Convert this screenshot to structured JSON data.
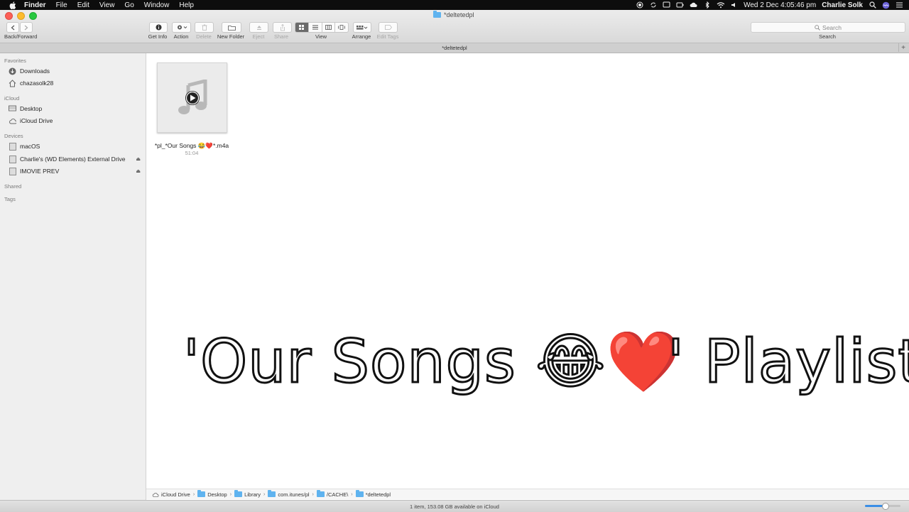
{
  "menubar": {
    "app_name": "Finder",
    "menus": [
      "File",
      "Edit",
      "View",
      "Go",
      "Window",
      "Help"
    ],
    "datetime": "Wed 2 Dec  4:05:46 pm",
    "user": "Charlie Solk",
    "status_icons": [
      "record-icon",
      "sync-icon",
      "screen-icon",
      "battery-icon",
      "cloud-icon",
      "bluetooth-icon",
      "wifi-icon",
      "volume-icon"
    ]
  },
  "window": {
    "title": "*deltetedpl",
    "tab_title": "*deltetedpl"
  },
  "toolbar": {
    "back_forward_label": "Back/Forward",
    "get_info_label": "Get Info",
    "action_label": "Action",
    "delete_label": "Delete",
    "new_folder_label": "New Folder",
    "eject_label": "Eject",
    "share_label": "Share",
    "view_label": "View",
    "arrange_label": "Arrange",
    "edit_tags_label": "Edit Tags",
    "search_placeholder": "Search",
    "search_label": "Search"
  },
  "sidebar": {
    "sections": [
      {
        "title": "Favorites",
        "items": [
          {
            "label": "Downloads",
            "icon": "downloads-icon"
          },
          {
            "label": "chazasolk28",
            "icon": "home-icon"
          }
        ]
      },
      {
        "title": "iCloud",
        "items": [
          {
            "label": "Desktop",
            "icon": "desktop-icon"
          },
          {
            "label": "iCloud Drive",
            "icon": "cloud-icon"
          }
        ]
      },
      {
        "title": "Devices",
        "items": [
          {
            "label": "macOS",
            "icon": "disk-icon"
          },
          {
            "label": "Charlie's (WD Elements) External Drive",
            "icon": "disk-icon",
            "eject": true
          },
          {
            "label": "IMOVIE PREV",
            "icon": "disk-icon",
            "eject": true
          }
        ]
      },
      {
        "title": "Shared",
        "items": []
      },
      {
        "title": "Tags",
        "items": []
      }
    ]
  },
  "content": {
    "file": {
      "name": "*pl_*Our Songs 😂❤️*.m4a",
      "duration": "51:04",
      "icon": "music-file-icon"
    },
    "overlay_text_part1": "'Our Songs 😂❤️",
    "overlay_text_part2": "' Playlist"
  },
  "pathbar": {
    "crumbs": [
      "iCloud Drive",
      "Desktop",
      "Library",
      "com.itunes/pl",
      "/CACHE\\",
      "*deltetedpl"
    ]
  },
  "status": {
    "text": "1 item, 153.08 GB available on iCloud",
    "zoom_fraction": 0.55
  },
  "colors": {
    "folder": "#5fb3ef",
    "close": "#fc5f57",
    "minimize": "#fdbc2e",
    "maximize": "#28c840"
  }
}
